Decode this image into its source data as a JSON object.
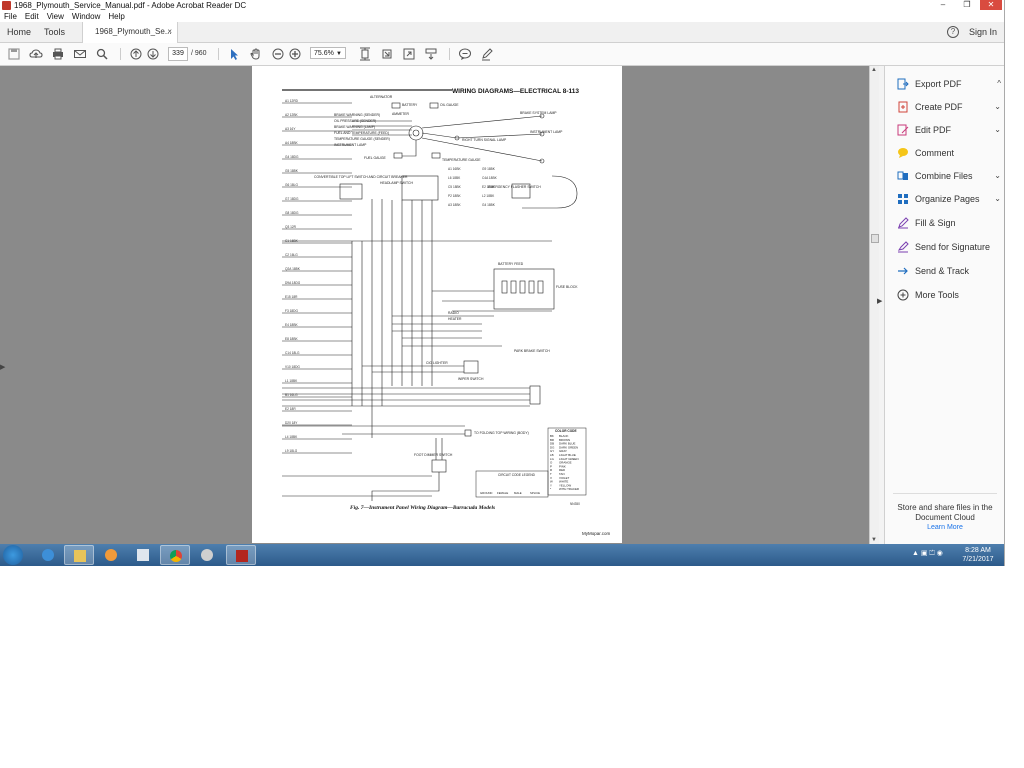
{
  "window": {
    "title": "1968_Plymouth_Service_Manual.pdf - Adobe Acrobat Reader DC",
    "controls": [
      "–",
      "❐",
      "✕"
    ]
  },
  "menu": [
    "File",
    "Edit",
    "View",
    "Window",
    "Help"
  ],
  "nav": {
    "home": "Home",
    "tools": "Tools",
    "doc_tab": "1968_Plymouth_Se...",
    "close": "×",
    "help": "?",
    "sign_in": "Sign In"
  },
  "toolbar": {
    "page_current": "339",
    "page_total": "/ 960",
    "zoom": "75.6%"
  },
  "document": {
    "header": "WIRING DIAGRAMS—ELECTRICAL   8-113",
    "caption": "Fig. 7—Instrument Panel Wiring Diagram—Barracuda Models",
    "watermark": "MyMopar.com",
    "figure_code": "NN350",
    "labels": {
      "alternator": "ALTERNATOR",
      "battery": "BATTERY",
      "oil_gauge": "OIL GAUGE",
      "ammeter": "AMMETER",
      "brake_warning": "BRAKE WARNING (SENDER)",
      "oil_pressure": "OIL PRESSURE (SENDER)",
      "brake_warning2": "BRAKE WARNING (LAMP)",
      "fuel_temp": "FUEL AND TEMPERATURE (FEED)",
      "temp_sender": "TEMPERATURE GAUGE (SENDER)",
      "inst_lamp": "INSTRUMENT LAMP",
      "fuel_gauge": "FUEL GAUGE",
      "temp_gauge": "TEMPERATURE GAUGE",
      "right_turn": "RIGHT TURN SIGNAL LAMP",
      "brake_sys_lamp": "BRAKE SYSTEM LAMP",
      "instrument_lamp": "INSTRUMENT LAMP",
      "conv_top": "CONVERTIBLE TOP LIFT SWITCH AND CIRCUIT BREAKER",
      "headlamp_switch": "HEADLAMP SWITCH",
      "emergency_flasher": "EMERGENCY FLASHER SWITCH",
      "battery_feed": "BATTERY FEED",
      "fuse_block": "FUSE BLOCK",
      "radio": "RADIO",
      "heater": "HEATER",
      "park_brake": "PARK BRAKE SWITCH",
      "wiper_switch": "WIPER SWITCH",
      "cig_lighter": "CIG LIGHTER",
      "foot_dimmer": "FOOT DIMMER SWITCH",
      "folding_top": "TO FOLDING TOP WIRING (BODY)",
      "circuit_legend": "CIRCUIT CODE LEGEND",
      "symbols": [
        "GROUND",
        "FEMALE",
        "MALE",
        "SPLICE"
      ]
    },
    "color_code": {
      "title": "COLOR CODE",
      "rows": [
        [
          "BK",
          "BLACK"
        ],
        [
          "BR",
          "BROWN"
        ],
        [
          "DB",
          "DARK BLUE"
        ],
        [
          "DG",
          "DARK GREEN"
        ],
        [
          "GY",
          "GRAY"
        ],
        [
          "LB",
          "LIGHT BLUE"
        ],
        [
          "LG",
          "LIGHT GREEN"
        ],
        [
          "O",
          "ORANGE"
        ],
        [
          "P",
          "PINK"
        ],
        [
          "R",
          "RED"
        ],
        [
          "T",
          "TAN"
        ],
        [
          "V",
          "VIOLET"
        ],
        [
          "W",
          "WHITE"
        ],
        [
          "Y",
          "YELLOW"
        ],
        [
          "*",
          "WITH TRACER"
        ]
      ]
    },
    "wire_codes_left": [
      "A1 12RD",
      "A2 12BK",
      "A3 16Y",
      "A4 18BK",
      "G4 18DG",
      "G5 18BK",
      "G6 18LG",
      "G7 18DG",
      "G8 18DG",
      "Q3 12R",
      "C1 16BK",
      "C2 16LG",
      "Q2A 18BK",
      "D9A 18DG",
      "E15 18R",
      "F3 18DG",
      "E4 18BK",
      "E8 18BK",
      "C14 18LG",
      "V10 18DG",
      "L1 18BK",
      "B1 16LG",
      "E2 18R",
      "D20 18Y",
      "L4 18BK",
      "L9 18LG"
    ],
    "wire_codes_right": [
      "A1 16BK",
      "G9 18BK",
      "L6 18BK",
      "C4A 18BK",
      "C5 18BK",
      "E2 18BK",
      "P2 18BK",
      "L2 18BK",
      "A3 18BK",
      "G4 18BK"
    ]
  },
  "right_panel": {
    "tools": [
      {
        "label": "Export PDF",
        "chevron": "^"
      },
      {
        "label": "Create PDF",
        "chevron": "⌄"
      },
      {
        "label": "Edit PDF",
        "chevron": "⌄"
      },
      {
        "label": "Comment",
        "chevron": ""
      },
      {
        "label": "Combine Files",
        "chevron": "⌄"
      },
      {
        "label": "Organize Pages",
        "chevron": "⌄"
      },
      {
        "label": "Fill & Sign",
        "chevron": ""
      },
      {
        "label": "Send for Signature",
        "chevron": ""
      },
      {
        "label": "Send & Track",
        "chevron": ""
      },
      {
        "label": "More Tools",
        "chevron": ""
      }
    ],
    "cloud_text": "Store and share files in the Document Cloud",
    "cloud_link": "Learn More"
  },
  "taskbar": {
    "time": "8:28 AM",
    "date": "7/21/2017",
    "tray": "▲ ▣ ⏍ ◉"
  }
}
